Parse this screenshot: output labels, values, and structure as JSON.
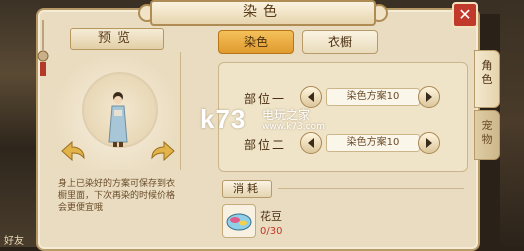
{
  "window": {
    "title": "染色",
    "close_label": "✕"
  },
  "preview": {
    "header": "预览",
    "description": "身上已染好的方案可保存到衣橱里面，下次再染的时候价格会更便宜哦"
  },
  "tabs": [
    {
      "label": "染色",
      "active": true
    },
    {
      "label": "衣橱",
      "active": false
    }
  ],
  "parts": [
    {
      "label": "部位一",
      "scheme": "染色方案10"
    },
    {
      "label": "部位二",
      "scheme": "染色方案10"
    }
  ],
  "cost": {
    "header": "消耗",
    "item_name": "花豆",
    "item_count": "0/30"
  },
  "side_tabs": [
    {
      "label": "角色",
      "active": true
    },
    {
      "label": "宠物",
      "active": false
    }
  ],
  "watermark": {
    "logo": "k73",
    "site_cn": "电玩之家",
    "url": "www.k73.com"
  },
  "friend_label": "好友",
  "colors": {
    "accent_tab": "#e9a93a",
    "close": "#c0392b",
    "count_red": "#c0392b"
  }
}
